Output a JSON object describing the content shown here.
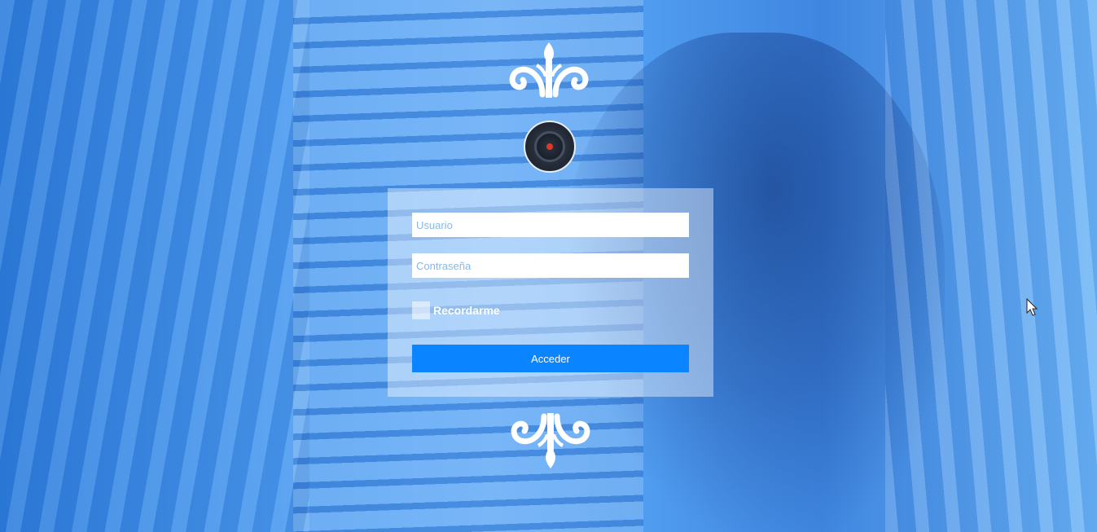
{
  "login": {
    "username_placeholder": "Usuario",
    "password_placeholder": "Contraseña",
    "remember_label": "Recordarme",
    "submit_label": "Acceder"
  },
  "icons": {
    "top_ornament": "fleur-ornament-icon",
    "bottom_ornament": "fleur-ornament-icon",
    "avatar": "camera-lens-icon",
    "cursor": "mouse-pointer-icon"
  },
  "colors": {
    "background_tint": "#4a9af0",
    "panel": "#ffffff",
    "button": "#0a84ff",
    "placeholder": "#8ab8e6",
    "lens_dot": "#e0392b"
  }
}
